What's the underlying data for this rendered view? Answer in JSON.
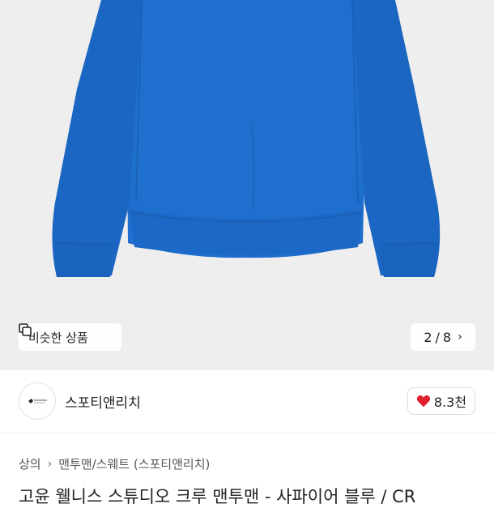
{
  "hero": {
    "similar_label": "비슷한 상품",
    "counter_current": "2",
    "counter_separator": "/",
    "counter_total": "8",
    "counter_next_icon": "chevron-right-icon"
  },
  "shop": {
    "name": "스포티앤리치",
    "likes": "8.3천",
    "heart_color": "#e0202e"
  },
  "breadcrumb": {
    "items": [
      "상의",
      "맨투맨/스웨트 (스포티앤리치)"
    ]
  },
  "product": {
    "title": "고윤 웰니스 스튜디오 크루 맨투맨 - 사파이어 블루 / CR"
  },
  "colors": {
    "sweater": "#1e6fd0",
    "background": "#eeeeee"
  }
}
